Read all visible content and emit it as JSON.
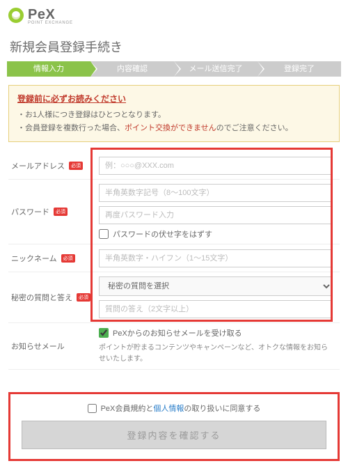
{
  "logo": {
    "brand": "PeX",
    "tagline": "POINT EXCHANGE"
  },
  "page_title": "新規会員登録手続き",
  "steps": [
    "情報入力",
    "内容確認",
    "メール送信完了",
    "登録完了"
  ],
  "notice": {
    "title": "登録前に必ずお読みください",
    "items": [
      {
        "text": "お1人様につき登録はひとつとなります。"
      },
      {
        "prefix": "会員登録を複数行った場合、",
        "warn": "ポイント交換ができません",
        "suffix": "のでご注意ください。"
      }
    ]
  },
  "form": {
    "email": {
      "label": "メールアドレス",
      "placeholder": "例：○○○@XXX.com"
    },
    "password": {
      "label": "パスワード",
      "placeholder1": "半角英数字記号（8〜100文字）",
      "placeholder2": "再度パスワード入力",
      "show_label": "パスワードの伏せ字をはずす"
    },
    "nickname": {
      "label": "ニックネーム",
      "placeholder": "半角英数字・ハイフン（1〜15文字）"
    },
    "secret": {
      "label": "秘密の質問と答え",
      "select_placeholder": "秘密の質問を選択",
      "answer_placeholder": "質問の答え（2文字以上）"
    },
    "newsletter": {
      "label": "お知らせメール",
      "check_label": "PeXからのお知らせメールを受け取る",
      "note": "ポイントが貯まるコンテンツやキャンペーンなど、オトクな情報をお知らせいたします。"
    },
    "required_badge": "必須"
  },
  "agree": {
    "prefix": "PeX会員規約と",
    "link": "個人情報",
    "suffix": "の取り扱いに同意する"
  },
  "submit": "登録内容を確認する"
}
